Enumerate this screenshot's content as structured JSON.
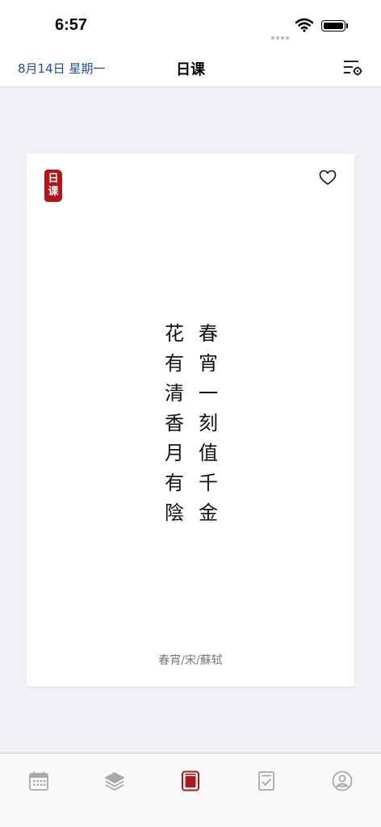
{
  "status_bar": {
    "time": "6:57"
  },
  "nav": {
    "date_label": "8月14日 星期一",
    "title": "日课"
  },
  "card": {
    "seal_chars": [
      "日",
      "课"
    ],
    "poem_columns": [
      [
        "春",
        "宵",
        "一",
        "刻",
        "值",
        "千",
        "金"
      ],
      [
        "花",
        "有",
        "清",
        "香",
        "月",
        "有",
        "陰"
      ]
    ],
    "source": "春宵/宋/蘇轼"
  },
  "tabs": [
    {
      "icon": "calendar-icon",
      "active": false
    },
    {
      "icon": "layers-icon",
      "active": false
    },
    {
      "icon": "card-icon",
      "active": true
    },
    {
      "icon": "checklist-icon",
      "active": false
    },
    {
      "icon": "profile-icon",
      "active": false
    }
  ],
  "colors": {
    "accent_red": "#b0161b",
    "date_blue": "#1f4f8f",
    "tab_inactive": "#a8a8ac",
    "background": "#f1f1f5"
  }
}
